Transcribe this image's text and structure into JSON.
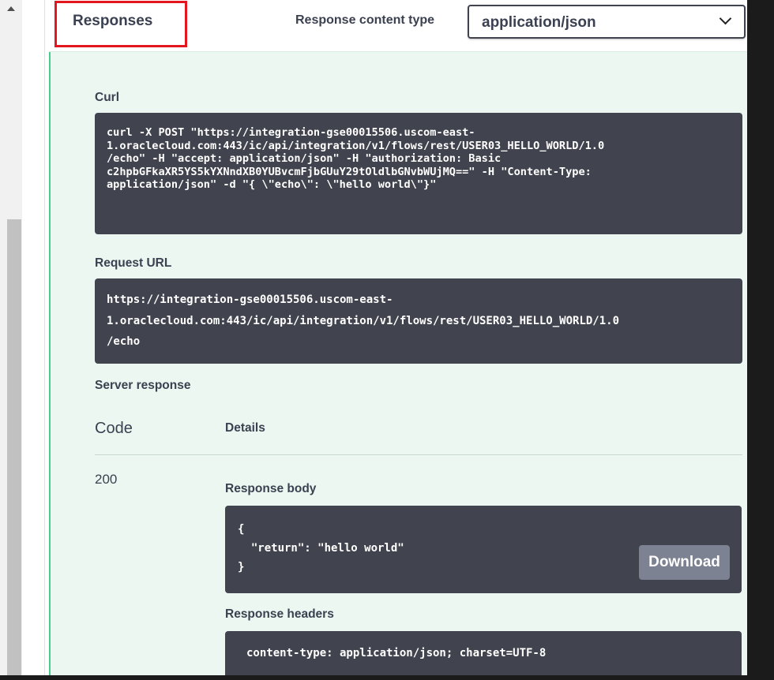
{
  "responses": {
    "title": "Responses",
    "content_type_label": "Response content type",
    "content_type_value": "application/json"
  },
  "curl": {
    "label": "Curl",
    "command": "curl -X POST \"https://integration-gse00015506.uscom-east-\n1.oraclecloud.com:443/ic/api/integration/v1/flows/rest/USER03_HELLO_WORLD/1.0\n/echo\" -H \"accept: application/json\" -H \"authorization: Basic\nc2hpbGFkaXR5YS5kYXNndXB0YUBvcmFjbGUuY29tOldlbGNvbWUjMQ==\" -H \"Content-Type:\napplication/json\" -d \"{ \\\"echo\\\": \\\"hello world\\\"}\""
  },
  "request_url": {
    "label": "Request URL",
    "value": "https://integration-gse00015506.uscom-east-\n1.oraclecloud.com:443/ic/api/integration/v1/flows/rest/USER03_HELLO_WORLD/1.0\n/echo"
  },
  "server_response": {
    "label": "Server response",
    "code_header": "Code",
    "details_header": "Details",
    "code": "200",
    "body_label": "Response body",
    "body": "{\n  \"return\": \"hello world\"\n}",
    "download_label": "Download",
    "headers_label": "Response headers",
    "headers": "content-type: application/json; charset=UTF-8"
  },
  "colors": {
    "accent_green": "#49cc90",
    "panel_bg": "#ebf7f0",
    "code_bg": "#41444e",
    "highlight_red": "#e3161d"
  }
}
